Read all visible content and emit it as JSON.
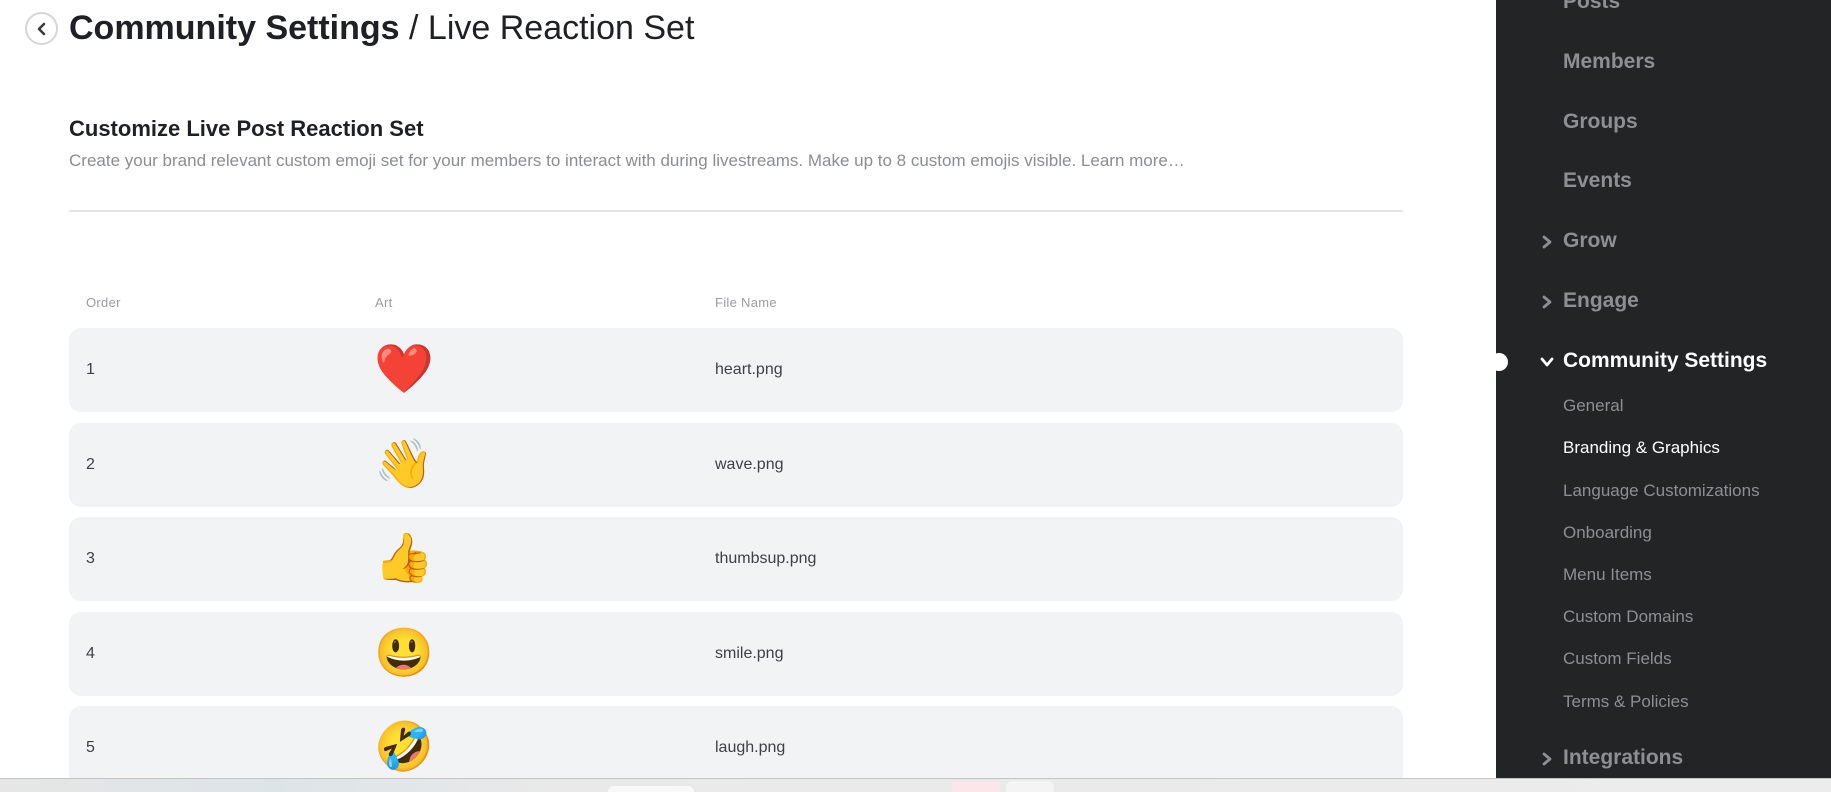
{
  "header": {
    "back_icon": "chevron-left-icon",
    "title_strong": "Community Settings",
    "title_separator": " / ",
    "title_sub": "Live Reaction Set"
  },
  "section": {
    "heading": "Customize Live Post Reaction Set",
    "description": "Create your brand relevant custom emoji set for your members to interact with during livestreams. Make up to 8 custom emojis visible. ",
    "learn_more": "Learn more…"
  },
  "table": {
    "columns": {
      "order": "Order",
      "art": "Art",
      "file_name": "File Name"
    },
    "rows": [
      {
        "order": "1",
        "art": "❤️",
        "art_icon": "heart-emoji",
        "file_name": "heart.png"
      },
      {
        "order": "2",
        "art": "👋",
        "art_icon": "wave-emoji",
        "file_name": "wave.png"
      },
      {
        "order": "3",
        "art": "👍",
        "art_icon": "thumbsup-emoji",
        "file_name": "thumbsup.png"
      },
      {
        "order": "4",
        "art": "😃",
        "art_icon": "smile-emoji",
        "file_name": "smile.png"
      },
      {
        "order": "5",
        "art": "🤣",
        "art_icon": "laugh-emoji",
        "file_name": "laugh.png"
      }
    ]
  },
  "sidebar": {
    "items": [
      {
        "label": "Posts"
      },
      {
        "label": "Members"
      },
      {
        "label": "Groups"
      },
      {
        "label": "Events"
      },
      {
        "label": "Grow",
        "chevron": "chevron-right-icon"
      },
      {
        "label": "Engage",
        "chevron": "chevron-right-icon"
      },
      {
        "label": "Community Settings",
        "chevron": "chevron-down-icon",
        "active": true
      },
      {
        "label": "Integrations",
        "chevron": "chevron-right-icon"
      }
    ],
    "sub_items": [
      {
        "label": "General"
      },
      {
        "label": "Branding & Graphics",
        "active": true
      },
      {
        "label": "Language Customizations"
      },
      {
        "label": "Onboarding"
      },
      {
        "label": "Menu Items"
      },
      {
        "label": "Custom Domains"
      },
      {
        "label": "Custom Fields"
      },
      {
        "label": "Terms & Policies"
      }
    ]
  },
  "colors": {
    "sidebar_bg": "#232426",
    "row_bg": "#f2f3f5",
    "muted_text": "#8b8d91",
    "active_nav": "#ffffff"
  }
}
